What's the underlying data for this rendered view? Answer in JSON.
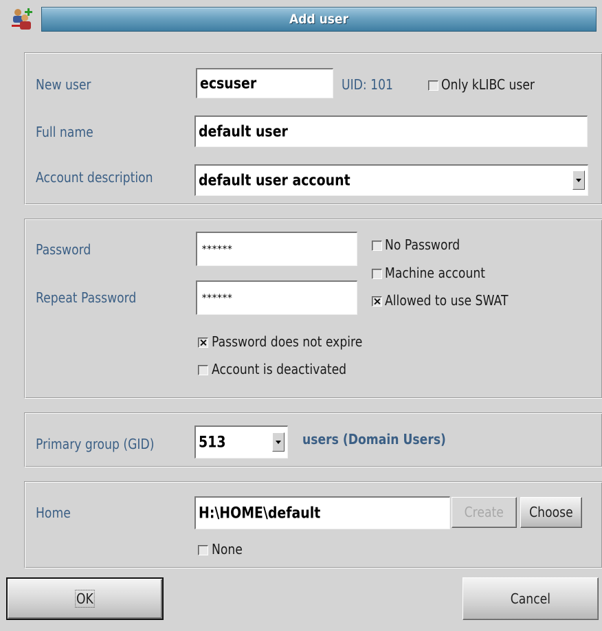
{
  "window": {
    "title": "Add user",
    "icon": "add-user-icon"
  },
  "user_section": {
    "new_user_label": "New user",
    "new_user_value": "ecsuser",
    "uid_text": "UID: 101",
    "only_klibc_label": "Only kLIBC user",
    "only_klibc_checked": false,
    "full_name_label": "Full name",
    "full_name_value": "default user",
    "account_description_label": "Account description",
    "account_description_value": "default user account"
  },
  "password_section": {
    "password_label": "Password",
    "password_value": "******",
    "repeat_password_label": "Repeat Password",
    "repeat_password_value": "******",
    "no_password_label": "No Password",
    "no_password_checked": false,
    "machine_account_label": "Machine account",
    "machine_account_checked": false,
    "allowed_swat_label": "Allowed to use SWAT",
    "allowed_swat_checked": true,
    "password_not_expire_label": "Password does not expire",
    "password_not_expire_checked": true,
    "account_deactivated_label": "Account is deactivated",
    "account_deactivated_checked": false
  },
  "group_section": {
    "primary_group_label": "Primary group (GID)",
    "gid_value": "513",
    "group_name": "users (Domain Users)"
  },
  "home_section": {
    "home_label": "Home",
    "home_value": "H:\\HOME\\default",
    "create_label": "Create",
    "choose_label": "Choose",
    "none_label": "None",
    "none_checked": false
  },
  "buttons": {
    "ok_label": "OK",
    "cancel_label": "Cancel"
  },
  "colors": {
    "label_blue": "#3b5f85",
    "title_bar": "#6aa1c0"
  }
}
